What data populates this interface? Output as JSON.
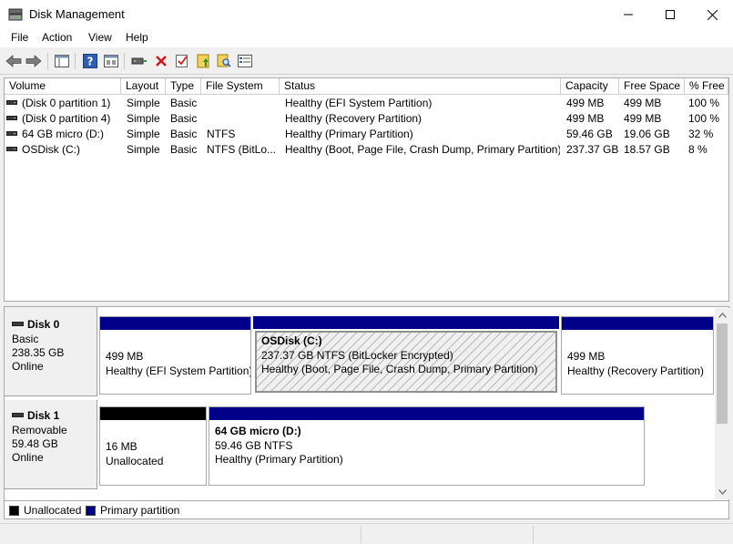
{
  "window": {
    "title": "Disk Management",
    "icons": {
      "app": "disk-management-icon",
      "minimize": "minimize-icon",
      "maximize": "maximize-icon",
      "close": "close-icon"
    }
  },
  "menu": [
    "File",
    "Action",
    "View",
    "Help"
  ],
  "toolbar": [
    "back-arrow-icon",
    "forward-arrow-icon",
    "console-tree-icon",
    "help-icon",
    "properties-icon",
    "connect-disk-icon",
    "delete-icon",
    "check-icon",
    "import-icon",
    "search-icon",
    "list-view-icon"
  ],
  "volume_table": {
    "columns": [
      "Volume",
      "Layout",
      "Type",
      "File System",
      "Status",
      "Capacity",
      "Free Space",
      "% Free"
    ],
    "rows": [
      [
        "(Disk 0 partition 1)",
        "Simple",
        "Basic",
        "",
        "Healthy (EFI System Partition)",
        "499 MB",
        "499 MB",
        "100 %"
      ],
      [
        "(Disk 0 partition 4)",
        "Simple",
        "Basic",
        "",
        "Healthy (Recovery Partition)",
        "499 MB",
        "499 MB",
        "100 %"
      ],
      [
        "64 GB micro (D:)",
        "Simple",
        "Basic",
        "NTFS",
        "Healthy (Primary Partition)",
        "59.46 GB",
        "19.06 GB",
        "32 %"
      ],
      [
        "OSDisk (C:)",
        "Simple",
        "Basic",
        "NTFS (BitLo...",
        "Healthy (Boot, Page File, Crash Dump, Primary Partition)",
        "237.37 GB",
        "18.57 GB",
        "8 %"
      ]
    ]
  },
  "disks": [
    {
      "name": "Disk 0",
      "type": "Basic",
      "size": "238.35 GB",
      "state": "Online",
      "partitions": [
        {
          "title": "",
          "line1": "499 MB",
          "line2": "Healthy (EFI System Partition)",
          "bar": "#00008b"
        },
        {
          "title": "OSDisk  (C:)",
          "line1": "237.37 GB NTFS (BitLocker Encrypted)",
          "line2": "Healthy (Boot, Page File, Crash Dump, Primary Partition)",
          "bar": "#00008b"
        },
        {
          "title": "",
          "line1": "499 MB",
          "line2": "Healthy (Recovery Partition)",
          "bar": "#00008b"
        }
      ]
    },
    {
      "name": "Disk 1",
      "type": "Removable",
      "size": "59.48 GB",
      "state": "Online",
      "partitions": [
        {
          "title": "",
          "line1": "16 MB",
          "line2": "Unallocated",
          "bar": "#000000"
        },
        {
          "title": "64 GB micro  (D:)",
          "line1": "59.46 GB NTFS",
          "line2": "Healthy (Primary Partition)",
          "bar": "#00008b"
        }
      ]
    }
  ],
  "legend": [
    {
      "label": "Unallocated",
      "color": "#000000"
    },
    {
      "label": "Primary partition",
      "color": "#00008b"
    }
  ]
}
